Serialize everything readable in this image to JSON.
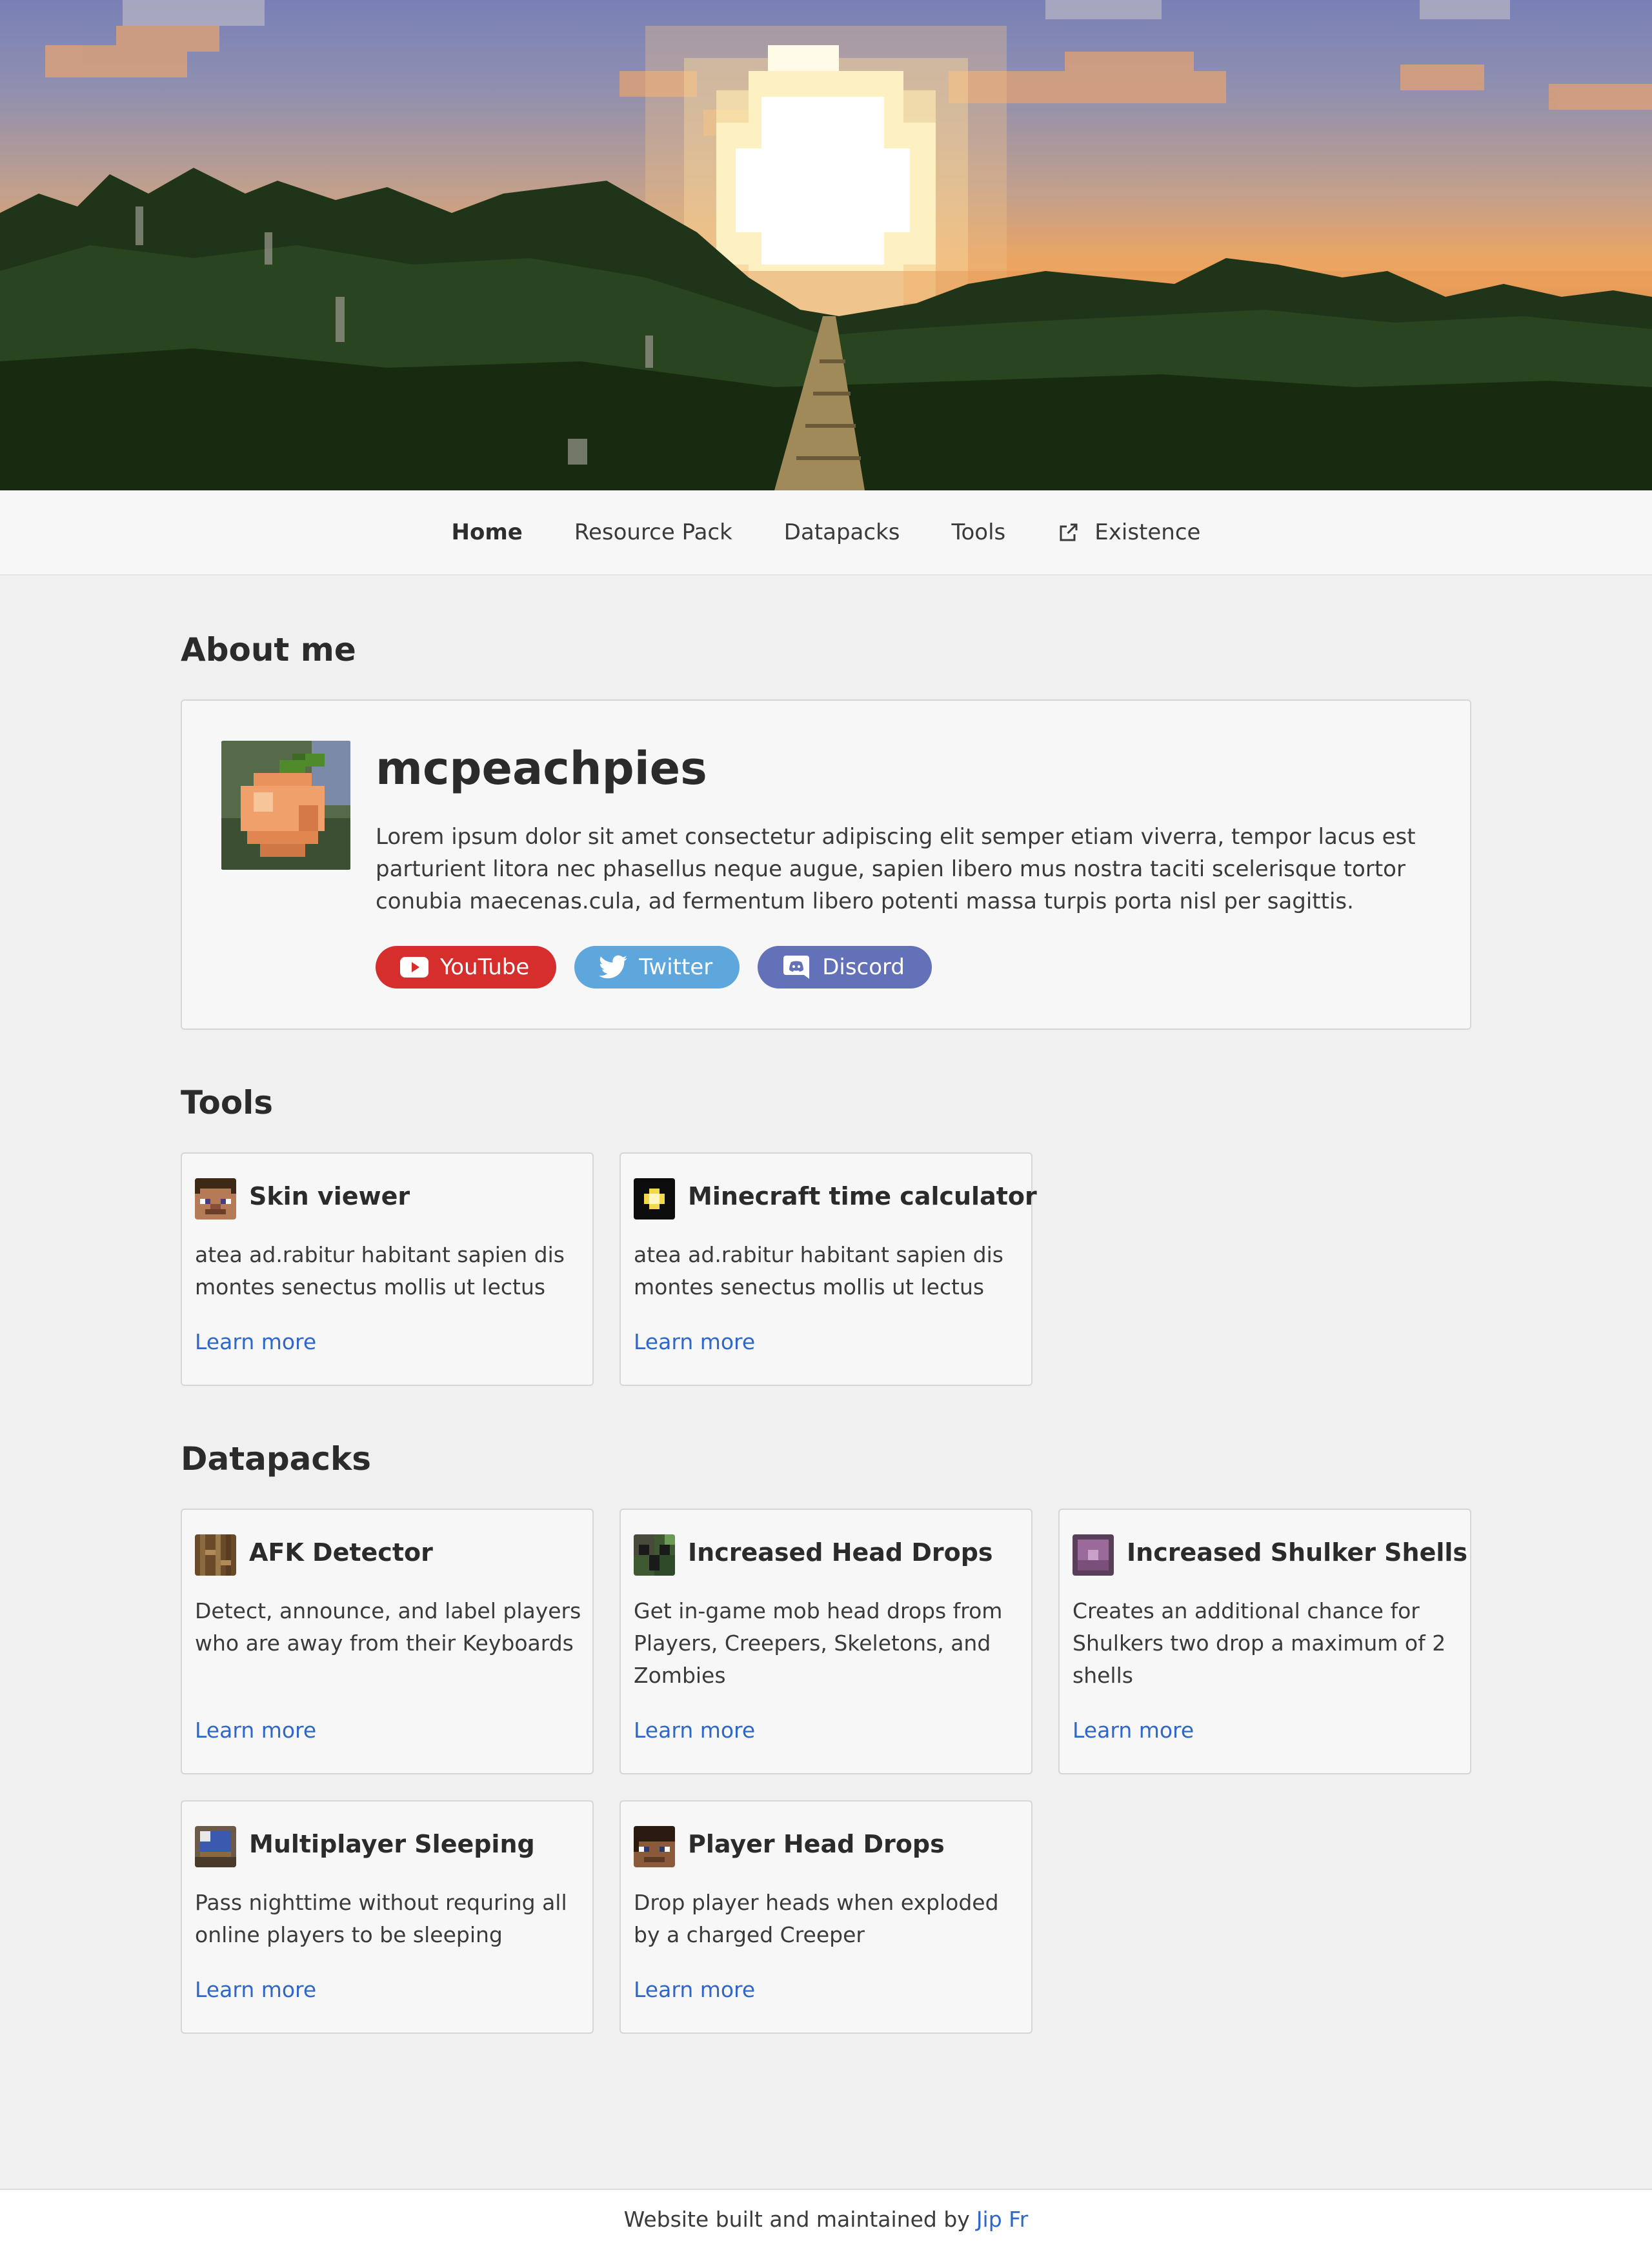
{
  "nav": {
    "items": [
      {
        "label": "Home"
      },
      {
        "label": "Resource Pack"
      },
      {
        "label": "Datapacks"
      },
      {
        "label": "Tools"
      },
      {
        "label": "Existence",
        "icon": "external-link-icon"
      }
    ]
  },
  "about": {
    "title": "About me",
    "username": "mcpeachpies",
    "bio": "Lorem ipsum dolor sit amet consectetur adipiscing elit semper etiam viverra, tempor lacus est parturient litora nec phasellus neque augue, sapien libero mus nostra taciti scelerisque tortor conubia maecenas.cula, ad fermentum libero potenti massa turpis porta nisl per sagittis.",
    "socials": [
      {
        "label": "YouTube",
        "icon": "youtube-icon",
        "color": "#d62d2d"
      },
      {
        "label": "Twitter",
        "icon": "twitter-icon",
        "color": "#5ea7dd"
      },
      {
        "label": "Discord",
        "icon": "discord-icon",
        "color": "#6271b8"
      }
    ]
  },
  "tools": {
    "title": "Tools",
    "items": [
      {
        "title": "Skin viewer",
        "desc": "atea ad.rabitur habitant sapien dis montes senectus mollis ut lectus",
        "link": "Learn more",
        "icon": "steve-head-icon"
      },
      {
        "title": "Minecraft time calculator",
        "desc": "atea ad.rabitur habitant sapien dis montes senectus mollis ut lectus",
        "link": "Learn more",
        "icon": "clock-icon"
      }
    ]
  },
  "datapacks": {
    "title": "Datapacks",
    "items": [
      {
        "title": "AFK Detector",
        "desc": "Detect, announce, and label players who are away from their Keyboards",
        "link": "Learn more",
        "icon": "afk-icon"
      },
      {
        "title": "Increased Head Drops",
        "desc": "Get in-game mob head drops from Players, Creepers, Skeletons, and Zombies",
        "link": "Learn more",
        "icon": "creeper-head-icon"
      },
      {
        "title": "Increased Shulker Shells",
        "desc": "Creates an additional chance for Shulkers two drop a maximum of 2 shells",
        "link": "Learn more",
        "icon": "shulker-icon"
      },
      {
        "title": "Multiplayer Sleeping",
        "desc": "Pass nighttime without requring all online players to be sleeping",
        "link": "Learn more",
        "icon": "bed-icon"
      },
      {
        "title": "Player Head Drops",
        "desc": "Drop player heads when exploded by a charged Creeper",
        "link": "Learn more",
        "icon": "player-head-icon"
      }
    ]
  },
  "footer": {
    "text": "Website built and maintained by",
    "link": "Jip Fr"
  }
}
